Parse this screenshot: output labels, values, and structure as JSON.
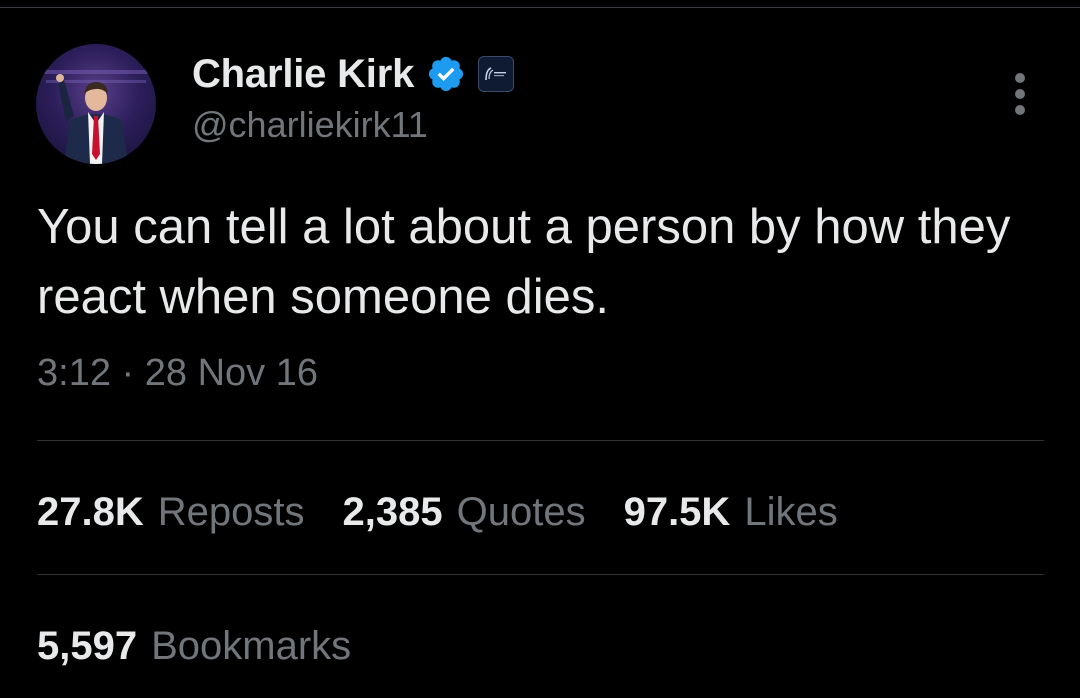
{
  "author": {
    "display_name": "Charlie Kirk",
    "handle": "@charliekirk11",
    "verified": true,
    "avatar_icon": "profile-photo",
    "affiliate_badge_icon": "organization-badge"
  },
  "tweet": {
    "text": "You can tell a lot about a person by how they react when someone dies.",
    "time": "3:12",
    "separator": "·",
    "date": "28 Nov 16"
  },
  "stats": {
    "reposts": {
      "count": "27.8K",
      "label": "Reposts"
    },
    "quotes": {
      "count": "2,385",
      "label": "Quotes"
    },
    "likes": {
      "count": "97.5K",
      "label": "Likes"
    },
    "bookmarks": {
      "count": "5,597",
      "label": "Bookmarks"
    }
  },
  "colors": {
    "background": "#000000",
    "primary_text": "#e7e9ea",
    "secondary_text": "#71767b",
    "divider": "#2f3336",
    "verified_blue": "#1d9bf0"
  },
  "icons": {
    "more": "more-vertical-icon",
    "verified": "verified-badge-icon"
  }
}
